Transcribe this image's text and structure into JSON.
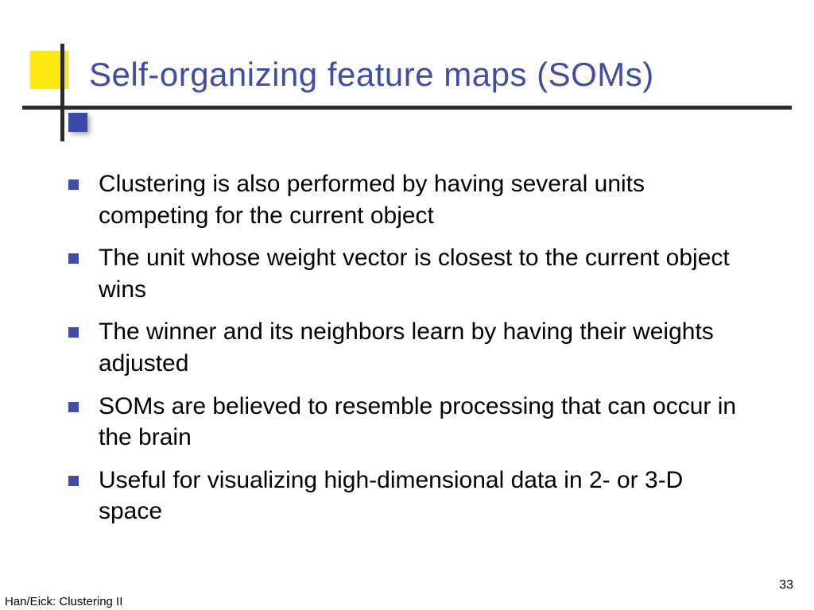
{
  "title": "Self-organizing feature maps (SOMs)",
  "bullets": [
    "Clustering is also performed by having several units competing for the current object",
    "The unit whose weight vector is closest to the current object wins",
    "The winner and its neighbors learn by having their weights adjusted",
    "SOMs are believed to resemble processing that can occur in the brain",
    "Useful for visualizing high-dimensional data in 2- or 3-D space"
  ],
  "footer": {
    "left": "Han/Eick: Clustering II",
    "page": "33"
  },
  "colors": {
    "title": "#3f4da6",
    "bullet_marker": "#3f4da6",
    "accent_yellow": "#fde910",
    "accent_blue": "#3a48a9"
  }
}
